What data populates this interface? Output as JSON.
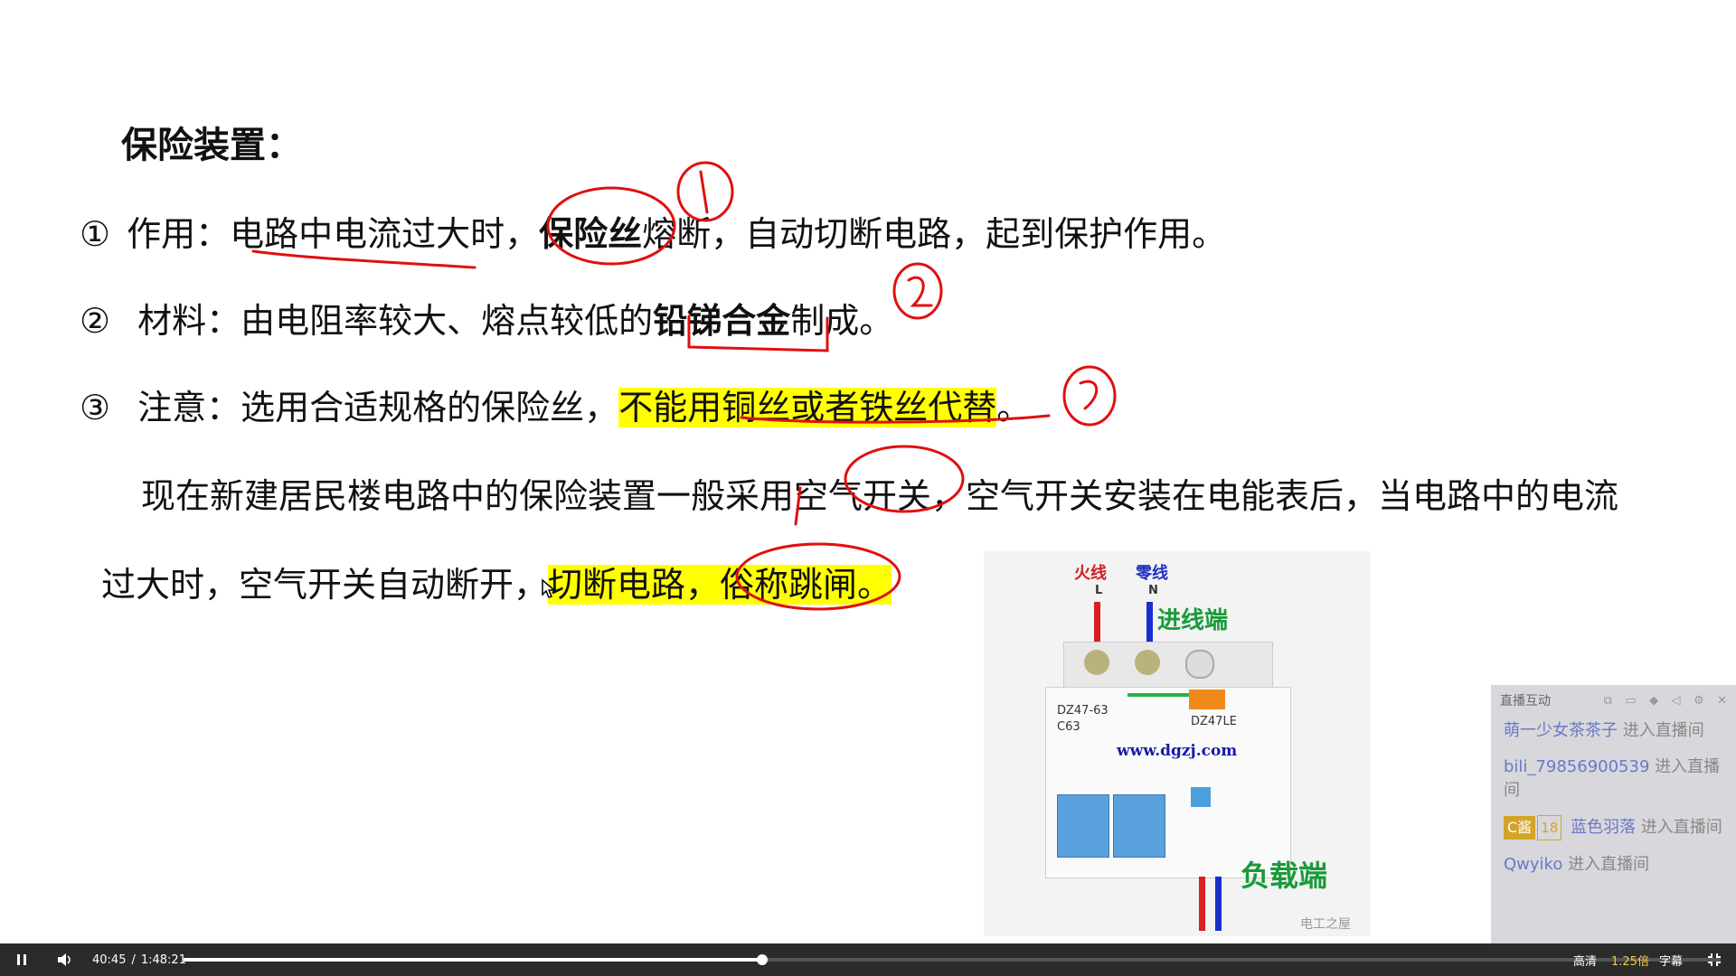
{
  "slide": {
    "title": "保险装置：",
    "item1": {
      "num": "①",
      "label": "作用：",
      "text_underlined": "电路中电流过大时，",
      "text_bold": "保险丝",
      "text_rest": "熔断，自动切断电路，起到保护作用。"
    },
    "item2": {
      "num": "②",
      "label": "材料：由电阻率较大、熔点较低的",
      "text_bold": "铅锑合金",
      "text_rest": "制成。"
    },
    "item3": {
      "num": "③",
      "label": "注意：选用合适规格的保险丝，",
      "text_highlight": "不能用铜丝或者铁丝代替",
      "text_rest": "。"
    },
    "para_line1": "现在新建居民楼电路中的保险装置一般采用空气开关，空气开关安装在电能表后，当电路中的电流",
    "para_line2_plain": "过大时，空气开关自动断开，",
    "para_line2_highlight": "切断电路，俗称跳闸。"
  },
  "breaker_image": {
    "live_label": "火线",
    "neutral_label": "零线",
    "input_label": "进线端",
    "load_label": "负载端",
    "L": "L",
    "N": "N",
    "model_left": "DZ47-63",
    "rating_left": "C63",
    "model_right": "DZ47LE",
    "website": "www.dgzj.com",
    "watermark": "电工之屋"
  },
  "chat": {
    "title": "直播互动",
    "items": [
      {
        "user": "萌一少女茶茶子",
        "msg": "进入直播间"
      },
      {
        "user": "bili_79856900539",
        "msg": "进入直播间"
      },
      {
        "badge": "C酱",
        "level": "18",
        "user": "蓝色羽落",
        "msg": "进入直播间"
      },
      {
        "user": "Qwyiko",
        "msg": "进入直播间"
      }
    ]
  },
  "player": {
    "current_time": "40:45",
    "separator": "/",
    "total_time": "1:48:21",
    "progress": 0.3766,
    "quality": "高清",
    "speed": "1.25倍",
    "subtitles": "字幕"
  }
}
